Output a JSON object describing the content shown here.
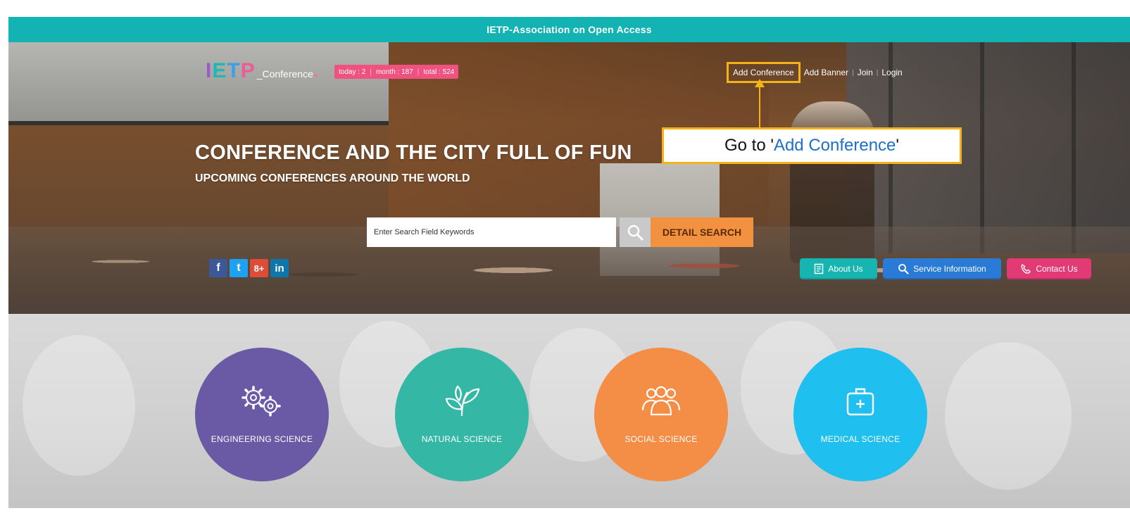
{
  "topbar": {
    "title": "IETP-Association on Open Access"
  },
  "header": {
    "logo": {
      "mark": [
        "I",
        "E",
        "T",
        "P"
      ],
      "text": "_Conference",
      "dot": "●"
    },
    "counter": {
      "today": "today : 2",
      "month": "month : 187",
      "total": "total : 524"
    },
    "nav": {
      "add_conference": "Add Conference",
      "add_banner": "Add Banner",
      "join": "Join",
      "login": "Login",
      "separator": "|"
    }
  },
  "annotation": {
    "prefix": "Go to '",
    "highlight": "Add Conference",
    "suffix": "'",
    "color": "#f4b31a"
  },
  "hero": {
    "headline": "CONFERENCE AND THE CITY FULL OF FUN",
    "subheadline": "UPCOMING CONFERENCES AROUND THE WORLD"
  },
  "search": {
    "placeholder": "Enter Search Field Keywords",
    "icon": "search-icon",
    "detail_label": "DETAIL SEARCH"
  },
  "social": {
    "facebook": "f",
    "twitter": "t",
    "googleplus": "8+",
    "linkedin": "in"
  },
  "hero_buttons": {
    "about": "About Us",
    "service": "Service Information",
    "contact": "Contact Us"
  },
  "categories": [
    {
      "label": "ENGINEERING SCIENCE",
      "icon": "gears-icon",
      "color": "#6a5aa6"
    },
    {
      "label": "NATURAL SCIENCE",
      "icon": "plant-icon",
      "color": "#34b8a5"
    },
    {
      "label": "SOCIAL SCIENCE",
      "icon": "people-icon",
      "color": "#f48d45"
    },
    {
      "label": "MEDICAL SCIENCE",
      "icon": "medical-kit-icon",
      "color": "#1fc0ef"
    }
  ],
  "colors": {
    "topbar": "#13b2b3",
    "accent_orange": "#f29140",
    "counter_pink": "#f0527f"
  }
}
